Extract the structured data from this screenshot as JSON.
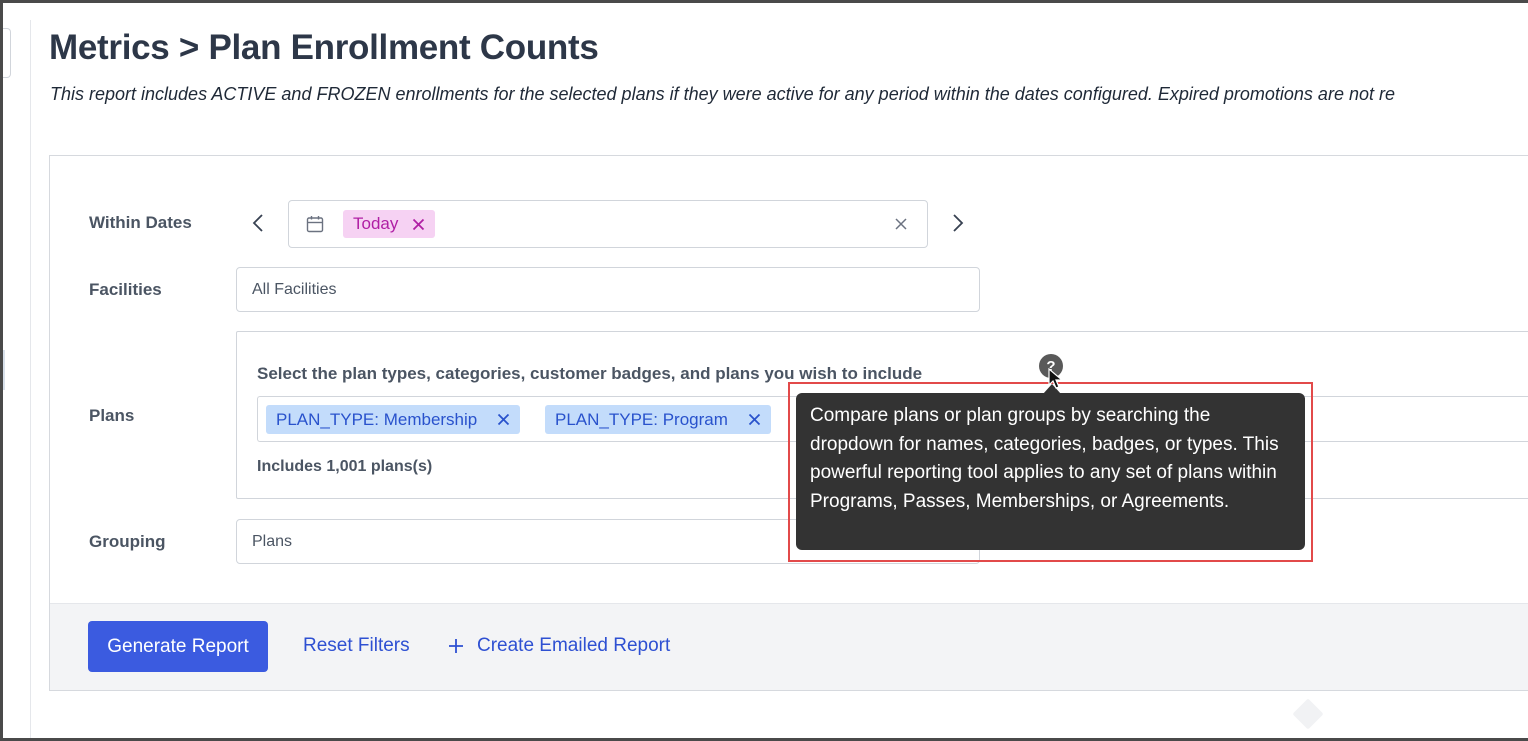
{
  "page": {
    "title": "Metrics > Plan Enrollment Counts",
    "description": "This report includes ACTIVE and FROZEN enrollments for the selected plans if they were active for any period within the dates configured. Expired promotions are not re"
  },
  "filters": {
    "within_dates": {
      "label": "Within Dates",
      "chip": "Today"
    },
    "facilities": {
      "label": "Facilities",
      "placeholder": "All Facilities"
    },
    "plans": {
      "label": "Plans",
      "heading": "Select the plan types, categories, customer badges, and plans you wish to include",
      "tags": [
        "PLAN_TYPE: Membership",
        "PLAN_TYPE: Program"
      ],
      "count_text": "Includes 1,001 plans(s)"
    },
    "grouping": {
      "label": "Grouping",
      "value": "Plans"
    }
  },
  "tooltip": {
    "text": "Compare plans or plan groups by searching the dropdown for names, categories, badges, or types. This powerful reporting tool applies to any set of plans within Programs, Passes, Memberships, or Agreements."
  },
  "actions": {
    "generate": "Generate Report",
    "reset": "Reset Filters",
    "create_emailed": "Create Emailed Report"
  },
  "colors": {
    "primary": "#3b5be0",
    "link": "#2e50d2",
    "today_chip_bg": "#f6d2f3",
    "today_chip_text": "#b01fa4",
    "plan_tag_bg": "#c3dcfb",
    "plan_tag_text": "#2952cc",
    "tooltip_bg": "#333333",
    "highlight_border": "#e24a4a"
  },
  "icons": [
    "calendar-icon",
    "chevron-left-icon",
    "chevron-right-icon",
    "close-icon",
    "question-circle-icon",
    "plus-icon",
    "mouse-cursor-icon"
  ]
}
